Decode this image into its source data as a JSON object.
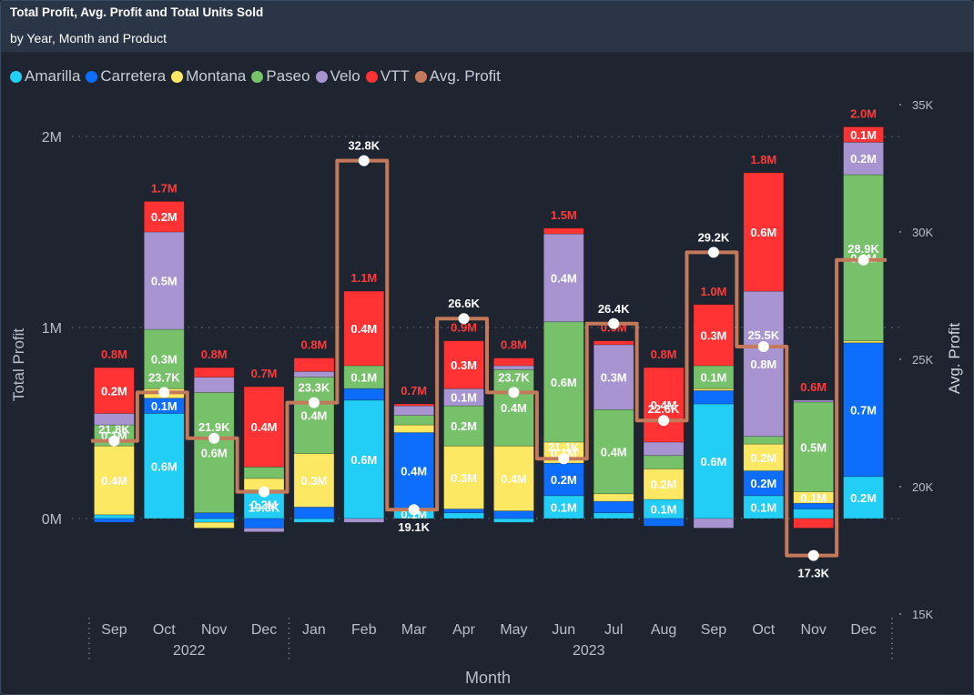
{
  "header": {
    "title": "Total Profit, Avg. Profit and Total Units Sold",
    "subtitle": "by Year, Month and Product"
  },
  "legend": [
    {
      "label": "Amarilla",
      "color": "#22cef5"
    },
    {
      "label": "Carretera",
      "color": "#0d6efd"
    },
    {
      "label": "Montana",
      "color": "#fde863"
    },
    {
      "label": "Paseo",
      "color": "#77c16b"
    },
    {
      "label": "Velo",
      "color": "#a894d0"
    },
    {
      "label": "VTT",
      "color": "#ff3333"
    },
    {
      "label": "Avg. Profit",
      "color": "#c47a5a"
    }
  ],
  "chart_data": {
    "type": "bar",
    "stacked": true,
    "combo_line": "step",
    "title": "Total Profit, Avg. Profit and Total Units Sold",
    "subtitle": "by Year, Month and Product",
    "xlabel": "Month",
    "ylabel": "Total Profit",
    "y2label": "Avg. Profit",
    "ylim": [
      -0.05,
      2.05
    ],
    "y_unit": "M",
    "y2lim": [
      15,
      35
    ],
    "y_ticks": [
      "0M",
      "1M",
      "2M"
    ],
    "y2_ticks": [
      "15K",
      "20K",
      "25K",
      "30K",
      "35K"
    ],
    "grid": true,
    "legend_position": "top-left",
    "categories": [
      "Sep",
      "Oct",
      "Nov",
      "Dec",
      "Jan",
      "Feb",
      "Mar",
      "Apr",
      "May",
      "Jun",
      "Jul",
      "Aug",
      "Sep",
      "Oct",
      "Nov",
      "Dec"
    ],
    "year_groups": [
      {
        "label": "2022",
        "months": 4
      },
      {
        "label": "2023",
        "months": 12
      }
    ],
    "series": [
      {
        "name": "Amarilla",
        "color": "#22cef5",
        "values": [
          0.02,
          0.55,
          -0.02,
          0.15,
          -0.02,
          0.62,
          0.05,
          0.03,
          -0.02,
          0.12,
          0.03,
          0.1,
          0.6,
          0.12,
          0.05,
          0.22
        ],
        "labels": [
          "",
          "0.6M",
          "",
          "0.2M",
          "",
          "0.6M",
          "0.1M",
          "",
          "",
          "0.1M",
          "",
          "0.1M",
          "0.6M",
          "0.1M",
          "",
          "0.2M"
        ]
      },
      {
        "name": "Carretera",
        "color": "#0d6efd",
        "values": [
          -0.02,
          0.08,
          0.03,
          -0.05,
          0.06,
          0.06,
          0.4,
          0.02,
          0.04,
          0.17,
          0.06,
          -0.04,
          0.07,
          0.13,
          0.03,
          0.7
        ],
        "labels": [
          "",
          "0.1M",
          "",
          "",
          "",
          "",
          "0.4M",
          "",
          "",
          "0.2M",
          "",
          "",
          "",
          "0.2M",
          "",
          "0.7M"
        ]
      },
      {
        "name": "Montana",
        "color": "#fde863",
        "values": [
          0.36,
          0.05,
          -0.03,
          0.06,
          0.28,
          0.0,
          0.04,
          0.33,
          0.34,
          0.11,
          0.04,
          0.16,
          0.01,
          0.14,
          0.06,
          0.01
        ],
        "labels": [
          "0.4M",
          "",
          "",
          "",
          "0.3M",
          "",
          "",
          "0.3M",
          "0.4M",
          "0.1M",
          "",
          "0.2M",
          "",
          "0.2M",
          "0.1M",
          ""
        ]
      },
      {
        "name": "Paseo",
        "color": "#77c16b",
        "values": [
          0.11,
          0.31,
          0.63,
          0.06,
          0.4,
          0.12,
          0.05,
          0.21,
          0.4,
          0.63,
          0.44,
          0.07,
          0.12,
          0.04,
          0.47,
          0.87
        ],
        "labels": [
          "0.1M",
          "0.3M",
          "0.6M",
          "",
          "0.4M",
          "0.1M",
          "",
          "0.2M",
          "0.4M",
          "0.6M",
          "0.4M",
          "",
          "0.1M",
          "",
          "0.5M",
          "0.9M"
        ]
      },
      {
        "name": "Velo",
        "color": "#a894d0",
        "values": [
          0.06,
          0.51,
          0.08,
          -0.02,
          0.03,
          -0.02,
          0.05,
          0.09,
          0.02,
          0.46,
          0.34,
          0.07,
          -0.05,
          0.76,
          0.01,
          0.17
        ],
        "labels": [
          "",
          "0.5M",
          "",
          "",
          "",
          "",
          "",
          "0.1M",
          "",
          "0.4M",
          "0.3M",
          "",
          "",
          "0.8M",
          "",
          "0.2M"
        ]
      },
      {
        "name": "VTT",
        "color": "#ff3333",
        "values": [
          0.24,
          0.16,
          0.05,
          0.42,
          0.07,
          0.39,
          0.01,
          0.25,
          0.04,
          0.03,
          0.02,
          0.39,
          0.32,
          0.62,
          -0.05,
          0.08
        ],
        "labels": [
          "0.2M",
          "0.2M",
          "",
          "0.4M",
          "",
          "0.4M",
          "",
          "0.3M",
          "",
          "",
          "",
          "0.4M",
          "0.3M",
          "0.6M",
          "",
          "0.1M"
        ]
      }
    ],
    "totals": [
      "0.8M",
      "1.7M",
      "0.8M",
      "0.7M",
      "0.8M",
      "1.1M",
      "0.7M",
      "0.9M",
      "0.8M",
      "1.5M",
      "0.9M",
      "0.8M",
      "1.0M",
      "1.8M",
      "0.6M",
      "2.0M"
    ],
    "avg_profit": {
      "name": "Avg. Profit",
      "color": "#c47a5a",
      "values": [
        21.8,
        23.7,
        21.9,
        19.8,
        23.3,
        32.8,
        19.1,
        26.6,
        23.7,
        21.1,
        26.4,
        22.6,
        29.2,
        25.5,
        17.3,
        28.9
      ],
      "labels": [
        "21.8K",
        "23.7K",
        "21.9K",
        "19.8K",
        "23.3K",
        "32.8K",
        "19.1K",
        "26.6K",
        "23.7K",
        "21.1K",
        "26.4K",
        "22.6K",
        "29.2K",
        "25.5K",
        "17.3K",
        "28.9K"
      ]
    }
  }
}
